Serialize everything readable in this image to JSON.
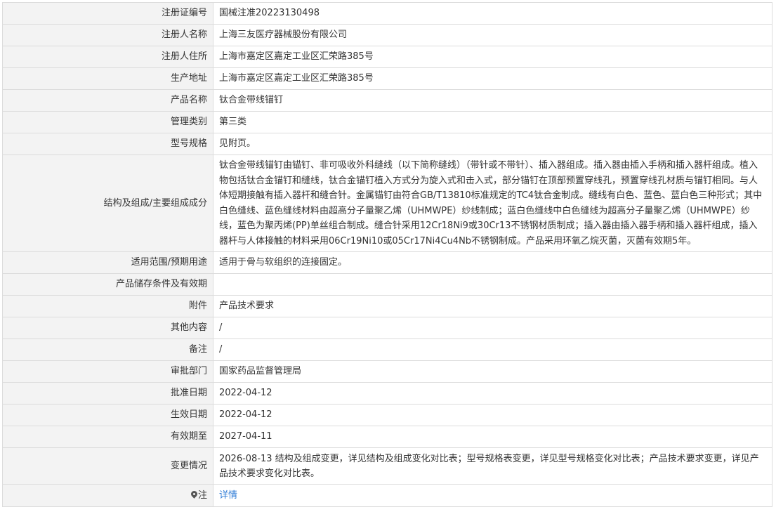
{
  "rows": [
    {
      "label": "注册证编号",
      "value": "国械注准20223130498"
    },
    {
      "label": "注册人名称",
      "value": "上海三友医疗器械股份有限公司"
    },
    {
      "label": "注册人住所",
      "value": "上海市嘉定区嘉定工业区汇荣路385号"
    },
    {
      "label": "生产地址",
      "value": "上海市嘉定区嘉定工业区汇荣路385号"
    },
    {
      "label": "产品名称",
      "value": "钛合金带线锚钉"
    },
    {
      "label": "管理类别",
      "value": "第三类"
    },
    {
      "label": "型号规格",
      "value": "见附页。"
    },
    {
      "label": "结构及组成/主要组成成分",
      "value": "钛合金带线锚钉由锚钉、非可吸收外科缝线（以下简称缝线）（带针或不带针）、插入器组成。插入器由插入手柄和插入器杆组成。植入物包括钛合金锚钉和缝线，钛合金锚钉植入方式分为旋入式和击入式，部分锚钉在顶部预置穿线孔，预置穿线孔材质与锚钉相同。与人体短期接触有插入器杆和缝合针。金属锚钉由符合GB/T13810标准规定的TC4钛合金制成。缝线有白色、蓝色、蓝白色三种形式；其中白色缝线、蓝色缝线材料由超高分子量聚乙烯（UHMWPE）纱线制成；蓝白色缝线中白色缝线为超高分子量聚乙烯（UHMWPE）纱线，蓝色为聚丙烯(PP)单丝组合制成。缝合针采用12Cr18Ni9或30Cr13不锈钢材质制成；插入器由插入器手柄和插入器杆组成，插入器杆与人体接触的材料采用06Cr19Ni10或05Cr17Ni4Cu4Nb不锈钢制成。产品采用环氧乙烷灭菌，灭菌有效期5年。"
    },
    {
      "label": "适用范围/预期用途",
      "value": "适用于骨与软组织的连接固定。"
    },
    {
      "label": "产品储存条件及有效期",
      "value": ""
    },
    {
      "label": "附件",
      "value": "产品技术要求"
    },
    {
      "label": "其他内容",
      "value": "/"
    },
    {
      "label": "备注",
      "value": "/"
    },
    {
      "label": "审批部门",
      "value": "国家药品监督管理局"
    },
    {
      "label": "批准日期",
      "value": "2022-04-12"
    },
    {
      "label": "生效日期",
      "value": "2022-04-12"
    },
    {
      "label": "有效期至",
      "value": "2027-04-11"
    },
    {
      "label": "变更情况",
      "value": "2026-08-13 结构及组成变更，详见结构及组成变化对比表；型号规格表变更，详见型号规格变化对比表；产品技术要求变更，详见产品技术要求变化对比表。"
    }
  ],
  "note": {
    "icon": "location-pin-icon",
    "label": "注",
    "link_text": "详情",
    "link_color": "#2d7bd6"
  }
}
